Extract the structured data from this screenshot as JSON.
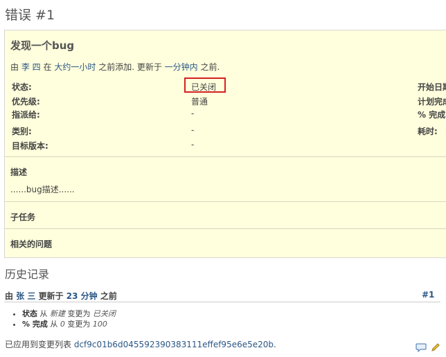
{
  "page": {
    "title": "错误 #1"
  },
  "issue": {
    "subject": "发现一个bug",
    "author_line": {
      "by": "由",
      "author": "李 四",
      "in": "在",
      "added_ago": "大约一小时",
      "added_text": "之前添加. 更新于",
      "updated_ago": "一分钟内",
      "updated_text": "之前."
    },
    "attributes": {
      "left": [
        {
          "label": "状态:",
          "value": "已关闭"
        },
        {
          "label": "优先级:",
          "value": "普通"
        },
        {
          "label": "指派给:",
          "value": "-"
        },
        {
          "label": "类别:",
          "value": "-"
        },
        {
          "label": "目标版本:",
          "value": "-"
        }
      ],
      "right": [
        {
          "label": "开始日期"
        },
        {
          "label": "计划完成"
        },
        {
          "label": "% 完成"
        },
        {
          "label": "耗时:"
        }
      ]
    },
    "description": {
      "title": "描述",
      "text": "......bug描述......"
    },
    "subtasks": {
      "title": "子任务"
    },
    "related": {
      "title": "相关的问题"
    }
  },
  "history": {
    "title": "历史记录",
    "journal": {
      "by": "由",
      "author": "张 三",
      "updated": "更新于",
      "ago": "23 分钟",
      "ago_suffix": "之前",
      "number": "#1",
      "details": [
        {
          "field": "状态",
          "from_word": "从",
          "from": "新建",
          "to_word": "变更为",
          "to": "已关闭"
        },
        {
          "field": "% 完成",
          "from_word": "从",
          "from": "0",
          "to_word": "变更为",
          "to": "100"
        }
      ],
      "changeset_prefix": "已应用到变更列表",
      "changeset": "dcf9c01b6d045592390383111effef95e6e5e20b",
      "changeset_suffix": "."
    }
  },
  "icons": {
    "quote": "comment-icon",
    "edit": "edit-pencil-icon"
  },
  "colors": {
    "link": "#2a5685",
    "box_bg": "#ffffdd",
    "highlight": "#d62020"
  }
}
